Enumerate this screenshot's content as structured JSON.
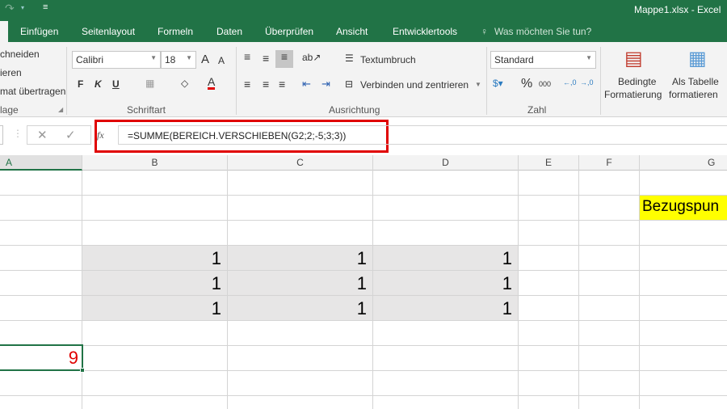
{
  "window": {
    "title": "Mappe1.xlsx - Excel"
  },
  "tabs": [
    "Einfügen",
    "Seitenlayout",
    "Formeln",
    "Daten",
    "Überprüfen",
    "Ansicht",
    "Entwicklertools"
  ],
  "tell_me": "Was möchten Sie tun?",
  "clipboard": {
    "cut": "chneiden",
    "copy": "ieren",
    "format_painter": "mat übertragen",
    "label": "lage"
  },
  "font": {
    "name": "Calibri",
    "size": "18",
    "bold": "F",
    "italic": "K",
    "underline": "U",
    "label": "Schriftart",
    "font_color": "#e00000"
  },
  "alignment": {
    "wrap": "Textumbruch",
    "merge": "Verbinden und zentrieren",
    "label": "Ausrichtung"
  },
  "number": {
    "format": "Standard",
    "percent": "%",
    "thousands": "000",
    "label": "Zahl"
  },
  "styles": {
    "conditional_1": "Bedingte",
    "conditional_2": "Formatierung",
    "table_1": "Als Tabelle",
    "table_2": "formatieren"
  },
  "formula_bar": {
    "fx": "fx",
    "formula": "=SUMME(BEREICH.VERSCHIEBEN(G2;2;-5;3;3))",
    "highlight_color": "#e00000"
  },
  "columns": [
    "A",
    "B",
    "C",
    "D",
    "E",
    "F",
    "G"
  ],
  "cells": {
    "grid_values": [
      [
        "1",
        "1",
        "1"
      ],
      [
        "1",
        "1",
        "1"
      ],
      [
        "1",
        "1",
        "1"
      ]
    ],
    "reference_label": "Bezugspun",
    "result": "9"
  }
}
